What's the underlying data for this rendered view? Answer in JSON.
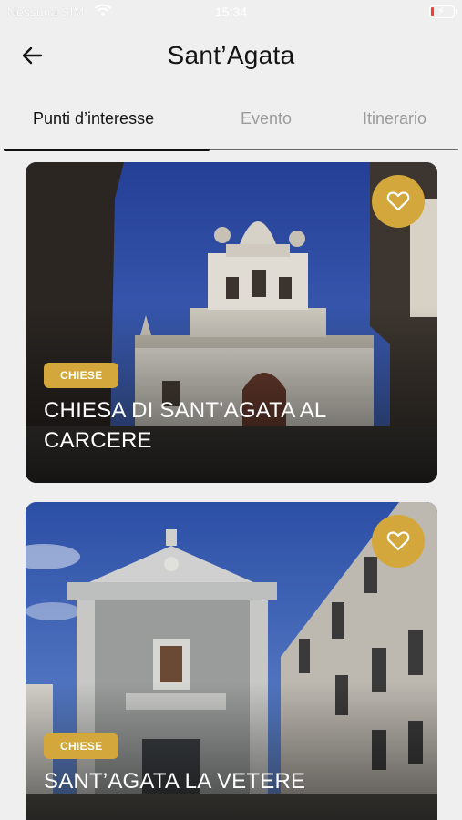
{
  "status_bar": {
    "carrier": "Nessuna SIM",
    "time": "15:34"
  },
  "header": {
    "title": "Sant’Agata"
  },
  "tabs": [
    {
      "label": "Punti d’interesse",
      "active": true
    },
    {
      "label": "Evento",
      "active": false
    },
    {
      "label": "Itinerario",
      "active": false
    }
  ],
  "cards": [
    {
      "category": "CHIESE",
      "title": "CHIESA DI SANT’AGATA AL CARCERE",
      "favorite": false
    },
    {
      "category": "CHIESE",
      "title": "SANT’AGATA LA VETERE",
      "favorite": false
    }
  ],
  "colors": {
    "accent": "#d3a73b",
    "background": "#efefef"
  },
  "icons": {
    "back": "arrow-left-icon",
    "favorite": "heart-outline-icon",
    "wifi": "wifi-icon",
    "battery": "battery-charging-icon"
  }
}
